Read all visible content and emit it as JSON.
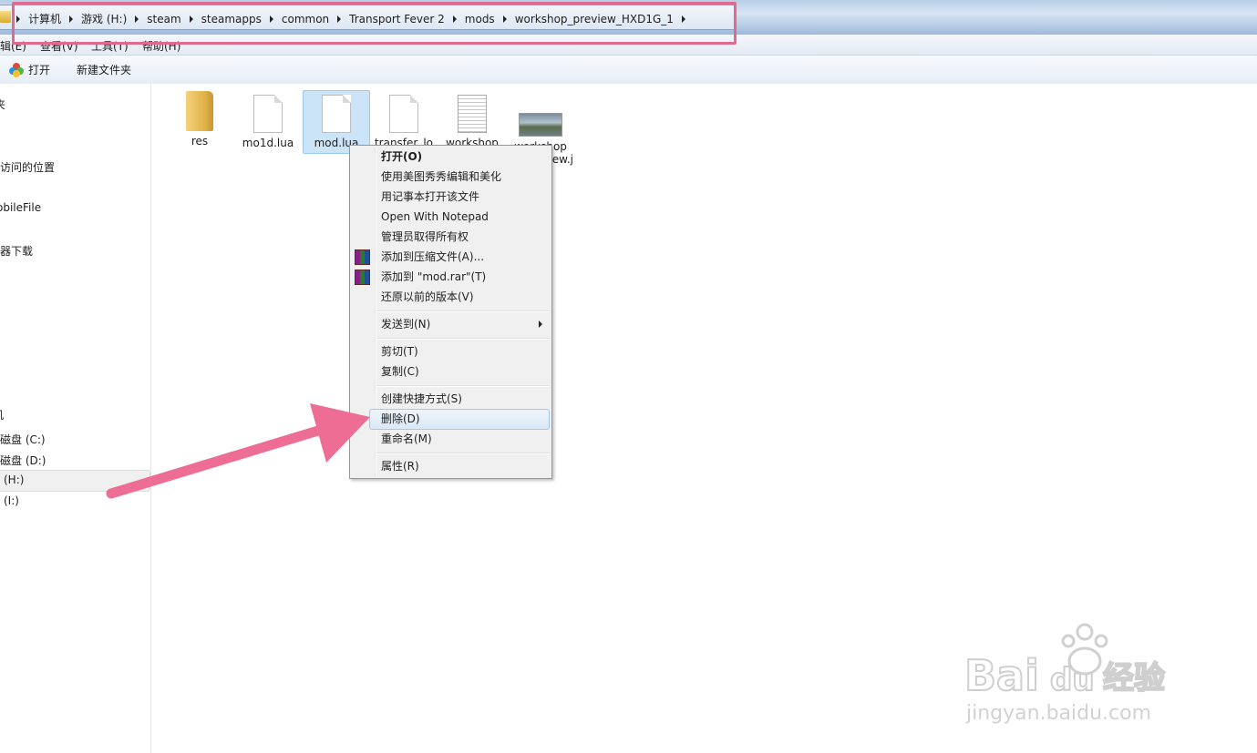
{
  "breadcrumb": [
    "计算机",
    "游戏 (H:)",
    "steam",
    "steamapps",
    "common",
    "Transport Fever 2",
    "mods",
    "workshop_preview_HXD1G_1"
  ],
  "menubar": [
    "编辑(E)",
    "查看(V)",
    "工具(T)",
    "帮助(H)"
  ],
  "toolbar": {
    "open": "打开",
    "new_folder": "新建文件夹"
  },
  "sidebar": [
    "夹",
    "访问的位置",
    "obileFile",
    "器下载",
    "机",
    "磁盘 (C:)",
    "磁盘 (D:)",
    "(H:)",
    "(I:)"
  ],
  "files": [
    {
      "name": "res",
      "icon": "folder-icon"
    },
    {
      "name": "mo1d.lua",
      "icon": "lua-file-icon"
    },
    {
      "name": "mod.lua",
      "icon": "lua-file-icon",
      "selected": true
    },
    {
      "name": "transfer_lo",
      "icon": "file-icon"
    },
    {
      "name": "workshop",
      "icon": "text-file-icon"
    },
    {
      "name": "workshop",
      "name_line2": "iew.j",
      "icon": "image-thumbnail-icon"
    }
  ],
  "context_menu": {
    "open": "打开(O)",
    "meitu": "使用美图秀秀编辑和美化",
    "notepad_cn": "用记事本打开该文件",
    "notepad_en": "Open With Notepad",
    "take_ownership": "管理员取得所有权",
    "add_archive": "添加到压缩文件(A)...",
    "add_rar": "添加到 \"mod.rar\"(T)",
    "restore": "还原以前的版本(V)",
    "send_to": "发送到(N)",
    "cut": "剪切(T)",
    "copy": "复制(C)",
    "shortcut": "创建快捷方式(S)",
    "delete": "删除(D)",
    "rename": "重命名(M)",
    "properties": "属性(R)"
  },
  "watermark": {
    "brand": "Bai",
    "brand_cn": "经验",
    "url": "jingyan.baidu.com"
  },
  "colors": {
    "highlight_box": "#e0698f",
    "arrow": "#ee6d95",
    "selection": "#cce4f7"
  }
}
